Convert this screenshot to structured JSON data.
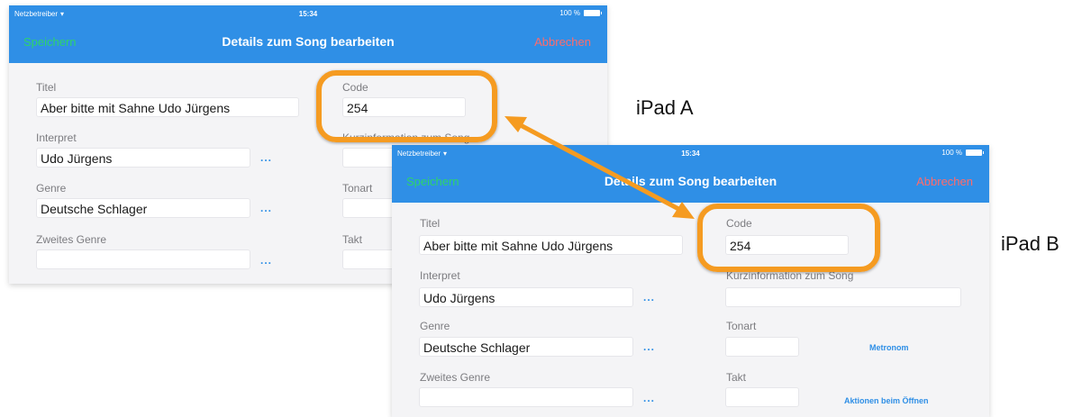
{
  "device_labels": {
    "a": "iPad A",
    "b": "iPad B"
  },
  "accent_colors": {
    "navbar": "#2f8fe6",
    "save": "#2ed36a",
    "cancel": "#ff6b6b",
    "highlight": "#f59b21"
  },
  "screen_a": {
    "status": {
      "carrier": "Netzbetreiber",
      "time": "15:34",
      "battery": "100 %"
    },
    "nav": {
      "save": "Speichern",
      "title": "Details zum Song bearbeiten",
      "cancel": "Abbrechen"
    },
    "form": {
      "titel_label": "Titel",
      "titel_value": "Aber bitte mit Sahne Udo Jürgens",
      "interpret_label": "Interpret",
      "interpret_value": "Udo Jürgens",
      "genre_label": "Genre",
      "genre_value": "Deutsche Schlager",
      "zweites_genre_label": "Zweites Genre",
      "zweites_genre_value": "",
      "code_label": "Code",
      "code_value": "254",
      "kurzinfo_label": "Kurzinformation zum Song",
      "tonart_label": "Tonart",
      "takt_label": "Takt",
      "more_button": "..."
    }
  },
  "screen_b": {
    "status": {
      "carrier": "Netzbetreiber",
      "time": "15:34",
      "battery": "100 %"
    },
    "nav": {
      "save": "Speichern",
      "title": "Details zum Song bearbeiten",
      "cancel": "Abbrechen"
    },
    "form": {
      "titel_label": "Titel",
      "titel_value": "Aber bitte mit Sahne Udo Jürgens",
      "interpret_label": "Interpret",
      "interpret_value": "Udo Jürgens",
      "genre_label": "Genre",
      "genre_value": "Deutsche Schlager",
      "zweites_genre_label": "Zweites Genre",
      "zweites_genre_value": "",
      "code_label": "Code",
      "code_value": "254",
      "kurzinfo_label": "Kurzinformation zum Song",
      "tonart_label": "Tonart",
      "takt_label": "Takt",
      "more_button": "...",
      "metronom_button": "Metronom",
      "aktionen_button": "Aktionen beim Öffnen"
    }
  }
}
